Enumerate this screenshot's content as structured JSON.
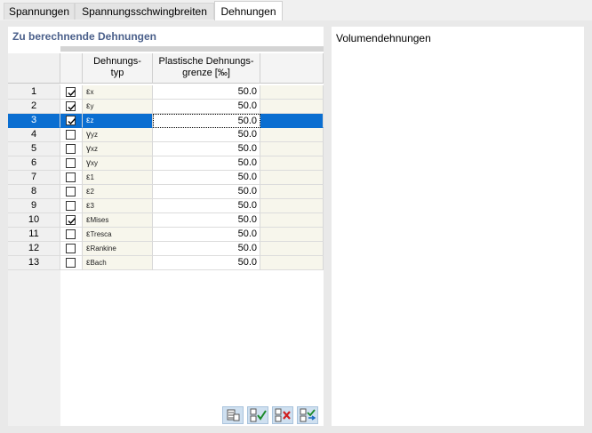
{
  "tabs": [
    {
      "label": "Spannungen",
      "active": false
    },
    {
      "label": "Spannungsschwingbreiten",
      "active": false
    },
    {
      "label": "Dehnungen",
      "active": true
    }
  ],
  "left_panel": {
    "title": "Zu berechnende Dehnungen",
    "columns": {
      "type_line1": "Dehnungs-",
      "type_line2": "typ",
      "limit_line1": "Plastische Dehnungs-",
      "limit_line2": "grenze [‰]"
    },
    "rows": [
      {
        "num": "1",
        "checked": true,
        "sym": "ε",
        "sub": "x",
        "value": "50.0"
      },
      {
        "num": "2",
        "checked": true,
        "sym": "ε",
        "sub": "y",
        "value": "50.0"
      },
      {
        "num": "3",
        "checked": true,
        "sym": "ε",
        "sub": "z",
        "value": "50.0",
        "selected": true
      },
      {
        "num": "4",
        "checked": false,
        "sym": "γ",
        "sub": "yz",
        "value": "50.0"
      },
      {
        "num": "5",
        "checked": false,
        "sym": "γ",
        "sub": "xz",
        "value": "50.0"
      },
      {
        "num": "6",
        "checked": false,
        "sym": "γ",
        "sub": "xy",
        "value": "50.0"
      },
      {
        "num": "7",
        "checked": false,
        "sym": "ε",
        "sub": "1",
        "value": "50.0"
      },
      {
        "num": "8",
        "checked": false,
        "sym": "ε",
        "sub": "2",
        "value": "50.0"
      },
      {
        "num": "9",
        "checked": false,
        "sym": "ε",
        "sub": "3",
        "value": "50.0"
      },
      {
        "num": "10",
        "checked": true,
        "sym": "ε",
        "sub": "Mises",
        "value": "50.0"
      },
      {
        "num": "11",
        "checked": false,
        "sym": "ε",
        "sub": "Tresca",
        "value": "50.0"
      },
      {
        "num": "12",
        "checked": false,
        "sym": "ε",
        "sub": "Rankine",
        "value": "50.0"
      },
      {
        "num": "13",
        "checked": false,
        "sym": "ε",
        "sub": "Bach",
        "value": "50.0"
      }
    ],
    "footer_icons": [
      "table-settings-icon",
      "check-all-icon",
      "uncheck-all-icon",
      "invert-selection-icon"
    ]
  },
  "right_panel": {
    "title": "Volumendehnungen"
  },
  "colors": {
    "selection": "#0a6ed1",
    "panel_title": "#4a5f8a",
    "type_column_bg": "#f7f6ec"
  }
}
